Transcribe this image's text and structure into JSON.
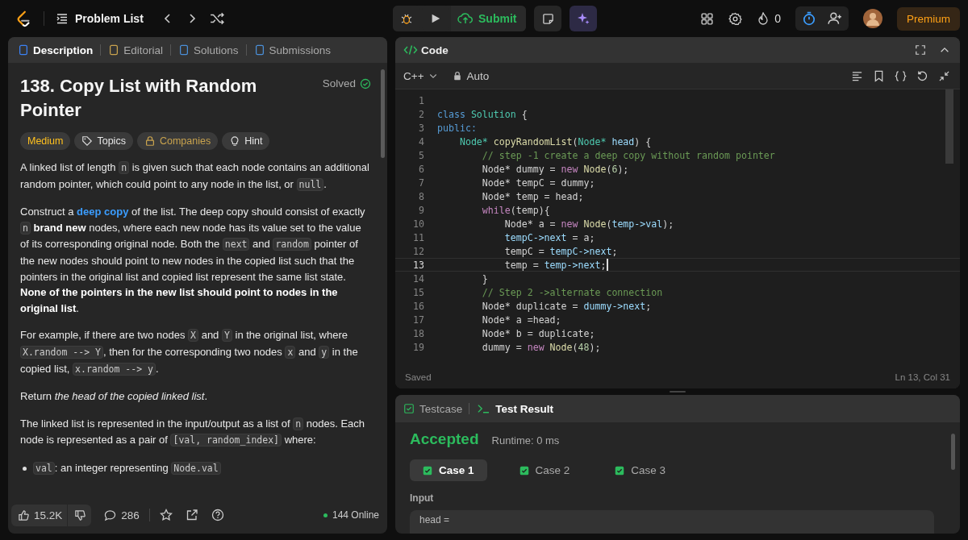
{
  "topbar": {
    "nav_title": "Problem List",
    "submit": "Submit",
    "streak": "0",
    "premium": "Premium"
  },
  "left_tabs": [
    {
      "label": "Description",
      "selected": true,
      "kind": "description"
    },
    {
      "label": "Editorial",
      "selected": false,
      "kind": "editorial"
    },
    {
      "label": "Solutions",
      "selected": false,
      "kind": "solutions"
    },
    {
      "label": "Submissions",
      "selected": false,
      "kind": "submissions"
    }
  ],
  "problem": {
    "title": "138. Copy List with Random Pointer",
    "status": "Solved",
    "tags": [
      {
        "label": "Medium",
        "kind": "difficulty"
      },
      {
        "label": "Topics",
        "kind": "topics"
      },
      {
        "label": "Companies",
        "kind": "companies"
      },
      {
        "label": "Hint",
        "kind": "hint"
      }
    ],
    "paragraphs": [
      {
        "kind": "paragraph",
        "runs": [
          {
            "kind": "text",
            "t": "A linked list of length "
          },
          {
            "kind": "code",
            "t": "n"
          },
          {
            "kind": "text",
            "t": " is given such that each node contains an additional random pointer, which could point to any node in the list, or "
          },
          {
            "kind": "code",
            "t": "null"
          },
          {
            "kind": "text",
            "t": "."
          }
        ]
      },
      {
        "kind": "paragraph",
        "runs": [
          {
            "kind": "text",
            "t": "Construct a "
          },
          {
            "kind": "link",
            "t": "deep copy"
          },
          {
            "kind": "text",
            "t": " of the list. The deep copy should consist of exactly "
          },
          {
            "kind": "code",
            "t": "n"
          },
          {
            "kind": "bold",
            "t": " brand new"
          },
          {
            "kind": "text",
            "t": " nodes, where each new node has its value set to the value of its corresponding original node. Both the "
          },
          {
            "kind": "code",
            "t": "next"
          },
          {
            "kind": "text",
            "t": " and "
          },
          {
            "kind": "code",
            "t": "random"
          },
          {
            "kind": "text",
            "t": " pointer of the new nodes should point to new nodes in the copied list such that the pointers in the original list and copied list represent the same list state. "
          },
          {
            "kind": "bold",
            "t": "None of the pointers in the new list should point to nodes in the original list"
          },
          {
            "kind": "text",
            "t": "."
          }
        ]
      },
      {
        "kind": "paragraph",
        "runs": [
          {
            "kind": "text",
            "t": "For example, if there are two nodes "
          },
          {
            "kind": "code",
            "t": "X"
          },
          {
            "kind": "text",
            "t": " and "
          },
          {
            "kind": "code",
            "t": "Y"
          },
          {
            "kind": "text",
            "t": " in the original list, where "
          },
          {
            "kind": "code",
            "t": "X.random --> Y"
          },
          {
            "kind": "text",
            "t": ", then for the corresponding two nodes "
          },
          {
            "kind": "code",
            "t": "x"
          },
          {
            "kind": "text",
            "t": " and "
          },
          {
            "kind": "code",
            "t": "y"
          },
          {
            "kind": "text",
            "t": " in the copied list, "
          },
          {
            "kind": "code",
            "t": "x.random --> y"
          },
          {
            "kind": "text",
            "t": "."
          }
        ]
      },
      {
        "kind": "paragraph",
        "runs": [
          {
            "kind": "text",
            "t": "Return "
          },
          {
            "kind": "italic",
            "t": "the head of the copied linked list"
          },
          {
            "kind": "text",
            "t": "."
          }
        ]
      },
      {
        "kind": "paragraph",
        "runs": [
          {
            "kind": "text",
            "t": "The linked list is represented in the input/output as a list of "
          },
          {
            "kind": "code",
            "t": "n"
          },
          {
            "kind": "text",
            "t": " nodes. Each node is represented as a pair of "
          },
          {
            "kind": "code",
            "t": "[val, random_index]"
          },
          {
            "kind": "text",
            "t": " where:"
          }
        ]
      },
      {
        "kind": "bullet",
        "runs": [
          {
            "kind": "code",
            "t": "val"
          },
          {
            "kind": "text",
            "t": ": an integer representing "
          },
          {
            "kind": "code",
            "t": "Node.val"
          }
        ]
      }
    ]
  },
  "footer": {
    "likes": "15.2K",
    "comments": "286",
    "online": "144 Online"
  },
  "editor": {
    "title": "Code",
    "language": "C++",
    "mode": "Auto",
    "status": "Saved",
    "cursor": "Ln 13, Col 31",
    "lines": [
      {
        "number": "1",
        "current": false
      },
      {
        "number": "2",
        "current": false,
        "tokens": [
          {
            "kind": "kw",
            "t": "class"
          },
          {
            "kind": "type",
            "t": " Solution"
          },
          {
            "kind": "plain",
            "t": " {"
          }
        ]
      },
      {
        "number": "3",
        "current": false,
        "tokens": [
          {
            "kind": "kw",
            "t": "public:"
          }
        ]
      },
      {
        "number": "4",
        "current": false,
        "tokens": [
          {
            "kind": "type",
            "t": "    Node*"
          },
          {
            "kind": "fn",
            "t": " copyRandomList"
          },
          {
            "kind": "plain",
            "t": "("
          },
          {
            "kind": "type",
            "t": "Node*"
          },
          {
            "kind": "var",
            "t": " head"
          },
          {
            "kind": "plain",
            "t": ") {"
          }
        ]
      },
      {
        "number": "5",
        "current": false,
        "tokens": [
          {
            "kind": "cmt",
            "t": "        // step -1 create a deep copy without random pointer"
          }
        ]
      },
      {
        "number": "6",
        "current": false,
        "tokens": [
          {
            "kind": "plain",
            "t": "        Node* dummy = "
          },
          {
            "kind": "new",
            "t": "new"
          },
          {
            "kind": "fn",
            "t": " Node"
          },
          {
            "kind": "plain",
            "t": "("
          },
          {
            "kind": "num",
            "t": "6"
          },
          {
            "kind": "plain",
            "t": ");"
          }
        ]
      },
      {
        "number": "7",
        "current": false,
        "tokens": [
          {
            "kind": "plain",
            "t": "        Node* tempC = dummy;"
          }
        ]
      },
      {
        "number": "8",
        "current": false,
        "tokens": [
          {
            "kind": "plain",
            "t": "        Node* temp = head;"
          }
        ]
      },
      {
        "number": "9",
        "current": false,
        "tokens": [
          {
            "kind": "new",
            "t": "        while"
          },
          {
            "kind": "plain",
            "t": "(temp){"
          }
        ]
      },
      {
        "number": "10",
        "current": false,
        "tokens": [
          {
            "kind": "plain",
            "t": "            Node* a = "
          },
          {
            "kind": "new",
            "t": "new"
          },
          {
            "kind": "fn",
            "t": " Node"
          },
          {
            "kind": "plain",
            "t": "("
          },
          {
            "kind": "var",
            "t": "temp->val"
          },
          {
            "kind": "plain",
            "t": ");"
          }
        ]
      },
      {
        "number": "11",
        "current": false,
        "tokens": [
          {
            "kind": "var",
            "t": "            tempC->next"
          },
          {
            "kind": "plain",
            "t": " = a;"
          }
        ]
      },
      {
        "number": "12",
        "current": false,
        "tokens": [
          {
            "kind": "plain",
            "t": "            tempC = "
          },
          {
            "kind": "var",
            "t": "tempC->next"
          },
          {
            "kind": "plain",
            "t": ";"
          }
        ]
      },
      {
        "number": "13",
        "current": true,
        "tokens": [
          {
            "kind": "plain",
            "t": "            temp = "
          },
          {
            "kind": "var",
            "t": "temp->next"
          },
          {
            "kind": "plain",
            "t": ";"
          }
        ]
      },
      {
        "number": "14",
        "current": false,
        "tokens": [
          {
            "kind": "plain",
            "t": "        }"
          }
        ]
      },
      {
        "number": "15",
        "current": false,
        "tokens": [
          {
            "kind": "cmt",
            "t": "        // Step 2 ->alternate connection"
          }
        ]
      },
      {
        "number": "16",
        "current": false,
        "tokens": [
          {
            "kind": "plain",
            "t": "        Node* duplicate = "
          },
          {
            "kind": "var",
            "t": "dummy->next"
          },
          {
            "kind": "plain",
            "t": ";"
          }
        ]
      },
      {
        "number": "17",
        "current": false,
        "tokens": [
          {
            "kind": "plain",
            "t": "        Node* a =head;"
          }
        ]
      },
      {
        "number": "18",
        "current": false,
        "tokens": [
          {
            "kind": "plain",
            "t": "        Node* b = duplicate;"
          }
        ]
      },
      {
        "number": "19",
        "current": false,
        "tokens": [
          {
            "kind": "plain",
            "t": "        dummy = "
          },
          {
            "kind": "new",
            "t": "new"
          },
          {
            "kind": "fn",
            "t": " Node"
          },
          {
            "kind": "plain",
            "t": "("
          },
          {
            "kind": "num",
            "t": "48"
          },
          {
            "kind": "plain",
            "t": ");"
          }
        ]
      }
    ]
  },
  "test_panel": {
    "tabs": [
      {
        "label": "Testcase",
        "selected": false,
        "kind": "testcase"
      },
      {
        "label": "Test Result",
        "selected": true,
        "kind": "result"
      }
    ],
    "verdict": "Accepted",
    "runtime": "Runtime: 0 ms",
    "cases": [
      {
        "label": "Case 1",
        "selected": true,
        "passed": true
      },
      {
        "label": "Case 2",
        "selected": false,
        "passed": true
      },
      {
        "label": "Case 3",
        "selected": false,
        "passed": true
      }
    ],
    "input_label": "Input",
    "input_value": "head ="
  }
}
